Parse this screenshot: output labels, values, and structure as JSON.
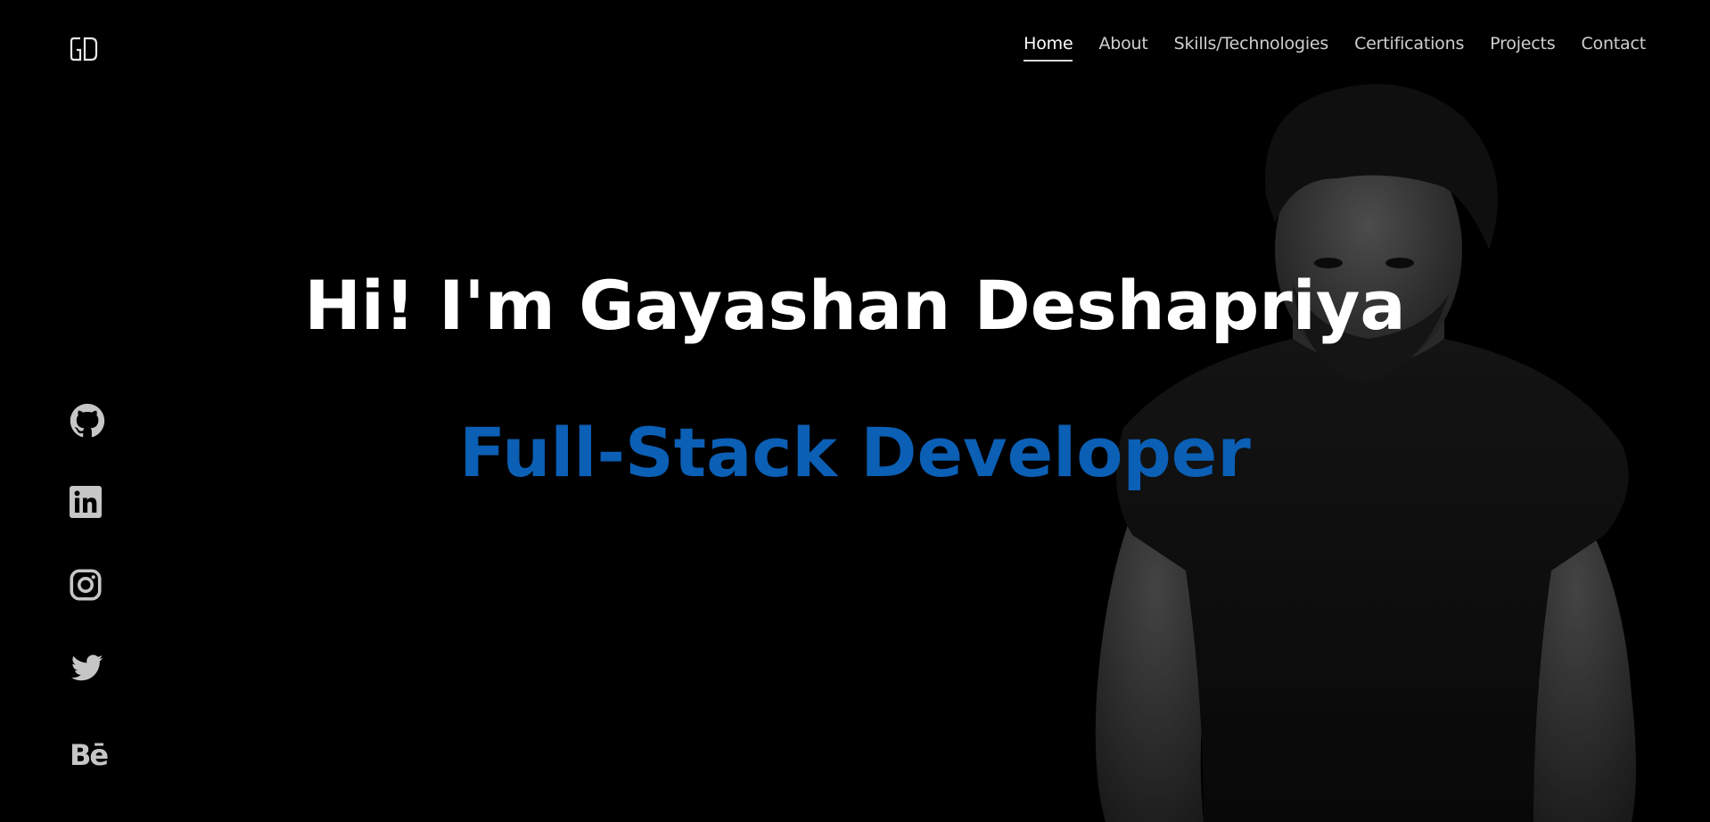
{
  "brand": {
    "logo_text": "GD"
  },
  "nav": {
    "items": [
      {
        "label": "Home",
        "active": true
      },
      {
        "label": "About",
        "active": false
      },
      {
        "label": "Skills/Technologies",
        "active": false
      },
      {
        "label": "Certifications",
        "active": false
      },
      {
        "label": "Projects",
        "active": false
      },
      {
        "label": "Contact",
        "active": false
      }
    ]
  },
  "hero": {
    "title": "Hi! I'm Gayashan Deshapriya",
    "subtitle": "Full-Stack Developer"
  },
  "social": [
    {
      "icon": "github-icon"
    },
    {
      "icon": "linkedin-icon"
    },
    {
      "icon": "instagram-icon"
    },
    {
      "icon": "twitter-icon"
    },
    {
      "icon": "behance-icon",
      "glyph": "Bē"
    }
  ],
  "colors": {
    "background": "#000000",
    "title": "#ffffff",
    "accent": "#0b5fb5",
    "nav_text": "#cfcfcf",
    "icon": "#c6c6c6"
  }
}
